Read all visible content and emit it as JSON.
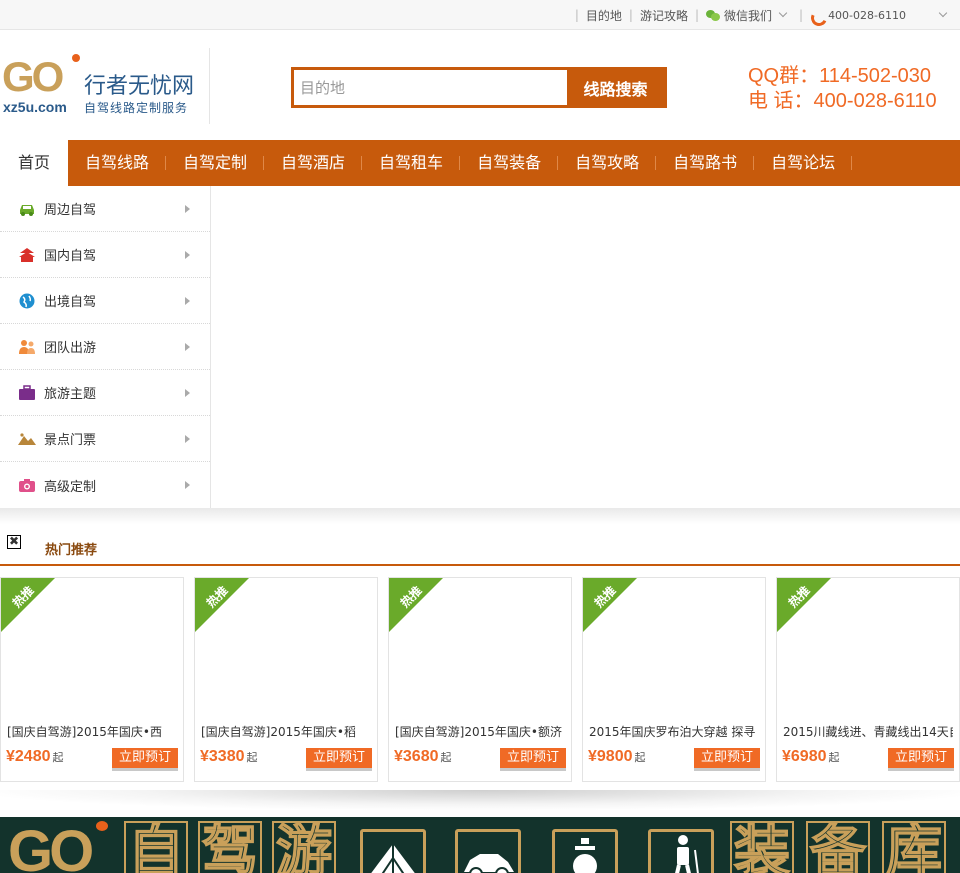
{
  "topbar": {
    "links": [
      "目的地",
      "游记攻略"
    ],
    "wechat_label": "微信我们",
    "phone": "400-028-6110"
  },
  "logo": {
    "mark": "GO",
    "name": "行者无忧网",
    "domain": "xz5u.com",
    "slogan": "自驾线路定制服务"
  },
  "search": {
    "placeholder": "目的地",
    "button_label": "线路搜索"
  },
  "contact": {
    "qq": "QQ群：114-502-030",
    "tel": "电  话：400-028-6110"
  },
  "nav": [
    "首页",
    "自驾线路",
    "自驾定制",
    "自驾酒店",
    "自驾租车",
    "自驾装备",
    "自驾攻略",
    "自驾路书",
    "自驾论坛"
  ],
  "side_menu": [
    {
      "label": "周边自驾",
      "icon": "car-icon",
      "color": "#6aaa2a"
    },
    {
      "label": "国内自驾",
      "icon": "temple-icon",
      "color": "#d9302a"
    },
    {
      "label": "出境自驾",
      "icon": "globe-icon",
      "color": "#1f8fd0"
    },
    {
      "label": "团队出游",
      "icon": "group-icon",
      "color": "#f08a3a"
    },
    {
      "label": "旅游主题",
      "icon": "suitcase-icon",
      "color": "#7a2d8a"
    },
    {
      "label": "景点门票",
      "icon": "landscape-icon",
      "color": "#b8863a"
    },
    {
      "label": "高级定制",
      "icon": "camera-icon",
      "color": "#e0508a"
    }
  ],
  "hot": {
    "close_symbol": "✖",
    "title": "热门推荐",
    "ribbon_label": "热推",
    "book_label": "立即预订",
    "price_suffix": "起",
    "items": [
      {
        "title": "[国庆自驾游]2015年国庆•西",
        "price": "¥2480"
      },
      {
        "title": "[国庆自驾游]2015年国庆•稻",
        "price": "¥3380"
      },
      {
        "title": "[国庆自驾游]2015年国庆•额济",
        "price": "¥3680"
      },
      {
        "title": "2015年国庆罗布泊大穿越 探寻",
        "price": "¥9800"
      },
      {
        "title": "2015川藏线进、青藏线出14天自",
        "price": "¥6980"
      }
    ]
  },
  "banner": {
    "mark": "GO",
    "chars": [
      "自",
      "驾",
      "游",
      "装",
      "备",
      "库"
    ],
    "tile_icons": [
      "tent-icon",
      "car-icon",
      "stove-icon",
      "hiker-icon"
    ]
  },
  "colors": {
    "brand_orange": "#c75a0c",
    "price_orange": "#f06a25",
    "ribbon_green": "#6aaa2a",
    "banner_bg": "#13332c",
    "logo_gold": "#c9a05a",
    "logo_blue": "#2a5a8a"
  }
}
